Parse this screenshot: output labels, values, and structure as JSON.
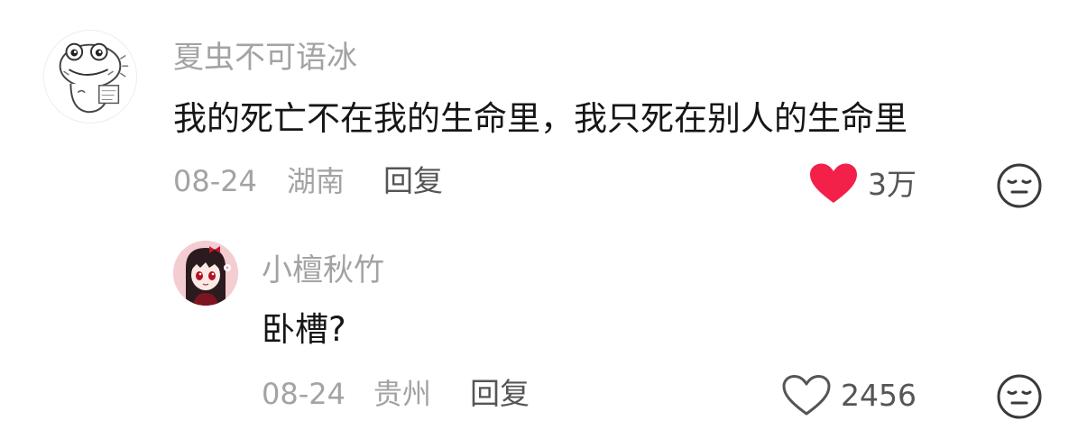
{
  "comments": [
    {
      "username": "夏虫不可语冰",
      "text": "我的死亡不在我的生命里，我只死在别人的生命里",
      "date": "08-24",
      "location": "湖南",
      "reply_label": "回复",
      "likes": "3万",
      "liked": true,
      "like_color": "#f3204a",
      "avatar": "cartoon-frog-sketch"
    },
    {
      "username": "小檀秋竹",
      "text": "卧槽?",
      "date": "08-24",
      "location": "贵州",
      "reply_label": "回复",
      "likes": "2456",
      "liked": false,
      "avatar": "anime-girl-pink-background"
    }
  ]
}
